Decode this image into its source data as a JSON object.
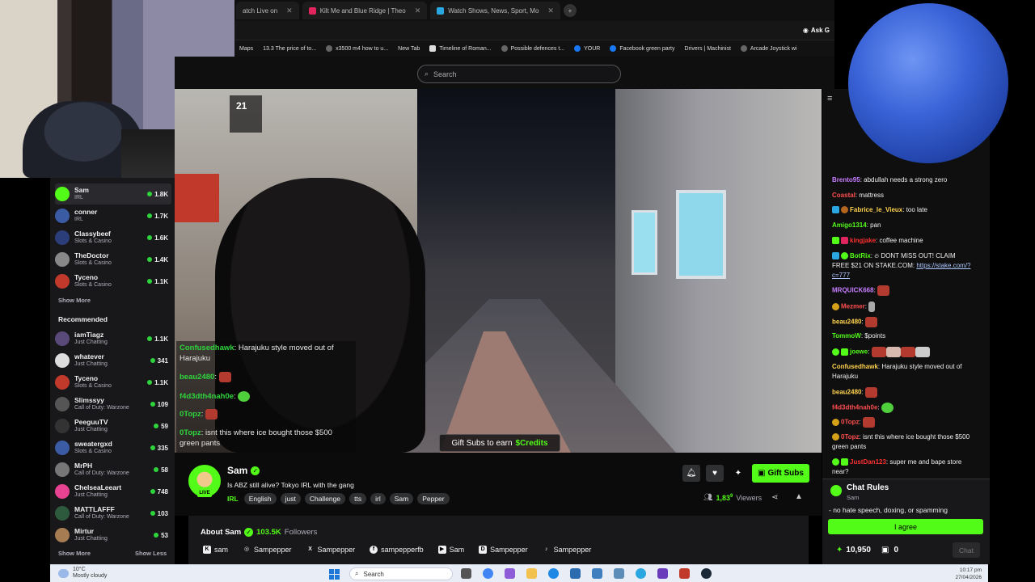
{
  "browser": {
    "tabs": [
      {
        "label": "atch Live on",
        "color": "#53fc18"
      },
      {
        "label": "Kilt Me and Blue Ridge | Theo",
        "color": "#e0245e"
      },
      {
        "label": "Watch Shows, News, Sport, Mo",
        "color": "#2aa7e0"
      }
    ],
    "ask_label": "Ask G",
    "bookmarks": [
      "Maps",
      "13.3 The price of to...",
      "x3500 m4 how to u...",
      "New Tab",
      "Timeline of Roman...",
      "Possible defences t...",
      "YOUR",
      "Facebook green party",
      "Drivers | Machinist",
      "Arcade Joystick wi"
    ]
  },
  "site": {
    "search_placeholder": "Search"
  },
  "sidebar": {
    "following": [
      {
        "name": "Sam",
        "category": "IRL",
        "viewers": "1.8K",
        "color": "#53fc18",
        "active": true
      },
      {
        "name": "conner",
        "category": "IRL",
        "viewers": "1.7K",
        "color": "#3b5ba5"
      },
      {
        "name": "Classybeef",
        "category": "Slots & Casino",
        "viewers": "1.6K",
        "color": "#2c3e7a"
      },
      {
        "name": "TheDoctor",
        "category": "Slots & Casino",
        "viewers": "1.4K",
        "color": "#888888"
      },
      {
        "name": "Tyceno",
        "category": "Slots & Casino",
        "viewers": "1.1K",
        "color": "#c0392b"
      }
    ],
    "show_more": "Show More",
    "recommended_title": "Recommended",
    "recommended": [
      {
        "name": "iamTiagz",
        "category": "Just Chatting",
        "viewers": "1.1K",
        "color": "#5a4a7a"
      },
      {
        "name": "whatever",
        "category": "Just Chatting",
        "viewers": "341",
        "color": "#dddddd"
      },
      {
        "name": "Tyceno",
        "category": "Slots & Casino",
        "viewers": "1.1K",
        "color": "#c0392b"
      },
      {
        "name": "Slimssyy",
        "category": "Call of Duty: Warzone",
        "viewers": "109",
        "color": "#555555"
      },
      {
        "name": "PeeguuTV",
        "category": "Just Chatting",
        "viewers": "59",
        "color": "#333333"
      },
      {
        "name": "sweatergxd",
        "category": "Slots & Casino",
        "viewers": "335",
        "color": "#3b5ba5"
      },
      {
        "name": "MrPH",
        "category": "Call of Duty: Warzone",
        "viewers": "58",
        "color": "#777777"
      },
      {
        "name": "ChelseaLeeart",
        "category": "Just Chatting",
        "viewers": "748",
        "color": "#e84393"
      },
      {
        "name": "MATTLAFFF",
        "category": "Call of Duty: Warzone",
        "viewers": "103",
        "color": "#2d5a3d"
      },
      {
        "name": "Mirtur",
        "category": "Just Chatting",
        "viewers": "53",
        "color": "#a67c52"
      }
    ],
    "show_more_2": "Show More",
    "show_less": "Show Less"
  },
  "video": {
    "clock_fragment": "21",
    "overlay": [
      {
        "user": "Confusedhawk",
        "color": "#2fd43d",
        "text": "Harajuku style moved out of Harajuku"
      },
      {
        "user": "beau2480",
        "color": "#2fd43d",
        "text": ""
      },
      {
        "user": "f4d3dth4nah0e",
        "color": "#2fd43d",
        "text": ""
      },
      {
        "user": "0Topz",
        "color": "#2fd43d",
        "text": ""
      },
      {
        "user": "0Topz",
        "color": "#2fd43d",
        "text": "isnt this where ice bought those $500 green pants"
      }
    ],
    "gift_banner_prefix": "Gift Subs to earn",
    "gift_banner_credits": "$Credits"
  },
  "stream": {
    "streamer": "Sam",
    "live_badge": "LIVE",
    "title": "Is ABZ still alive? Tokyo IRL with the gang",
    "category": "IRL",
    "tags": [
      "English",
      "just",
      "Challenge",
      "tts",
      "irl",
      "Sam",
      "Pepper"
    ],
    "gift_subs_label": "Gift Subs",
    "viewers_count": "1,83",
    "viewers_sup": "9",
    "viewers_label": "Viewers"
  },
  "about": {
    "title": "About Sam",
    "followers": "103.5K",
    "followers_label": "Followers",
    "socials": [
      {
        "icon": "kick-icon",
        "glyph": "K",
        "label": "sam"
      },
      {
        "icon": "instagram-icon",
        "glyph": "◎",
        "label": "Sampepper"
      },
      {
        "icon": "x-icon",
        "glyph": "X",
        "label": "Sampepper"
      },
      {
        "icon": "facebook-icon",
        "glyph": "f",
        "label": "sampepperfb"
      },
      {
        "icon": "youtube-icon",
        "glyph": "▶",
        "label": "Sam"
      },
      {
        "icon": "discord-icon",
        "glyph": "D",
        "label": "Sampepper"
      },
      {
        "icon": "tiktok-icon",
        "glyph": "♪",
        "label": "Sampepper"
      }
    ]
  },
  "chat": {
    "messages": [
      {
        "user": "Brento95",
        "color": "#c77dff",
        "text": "abdullah needs a strong zero"
      },
      {
        "user": "Coastal",
        "color": "#ff4d4d",
        "text": "mattress"
      },
      {
        "user": "Fabrice_le_Vieux",
        "color": "#ffd34e",
        "text": "too late"
      },
      {
        "user": "Amigo1314",
        "color": "#53fc18",
        "text": "pan"
      },
      {
        "user": "kingjake",
        "color": "#ff3030",
        "text": "coffee machine"
      },
      {
        "user": "BotRix",
        "color": "#53fc18",
        "text": "DONT MISS OUT! CLAIM FREE $21 ON STAKE.COM:",
        "link": "https://stake.com/?c=777"
      },
      {
        "user": "MRQUICK668",
        "color": "#c77dff",
        "text": ""
      },
      {
        "user": "Mezmer",
        "color": "#ff4d4d",
        "text": ""
      },
      {
        "user": "beau2480",
        "color": "#ffd34e",
        "text": ""
      },
      {
        "user": "TommoW",
        "color": "#53fc18",
        "text": "$points"
      },
      {
        "user": "joewe",
        "color": "#53fc18",
        "text": ""
      },
      {
        "user": "Confusedhawk",
        "color": "#ffd34e",
        "text": "Harajuku style moved out of Harajuku"
      },
      {
        "user": "beau2480",
        "color": "#ffd34e",
        "text": ""
      },
      {
        "user": "f4d3dth4nah0e",
        "color": "#ff4d4d",
        "text": ""
      },
      {
        "user": "0Topz",
        "color": "#ff4d4d",
        "text": ""
      },
      {
        "user": "0Topz",
        "color": "#ff4d4d",
        "text": "isnt this where ice bought those $500 green pants"
      },
      {
        "user": "JustDan123",
        "color": "#ff3030",
        "text": "super me and bape store near?"
      }
    ],
    "rules_title": "Chat Rules",
    "rules_sub": "Sam",
    "rules_text": "- no hate speech, doxing, or spamming",
    "agree_label": "I agree",
    "points": "10,950",
    "gifts": "0",
    "chat_button": "Chat"
  },
  "taskbar": {
    "temp": "10°C",
    "weather": "Mostly cloudy",
    "search": "Search",
    "time": "10:17 pm",
    "date": "27/04/2026"
  },
  "colors": {
    "accent": "#53fc18",
    "background": "#0b0b0c",
    "panel": "#18181b"
  }
}
